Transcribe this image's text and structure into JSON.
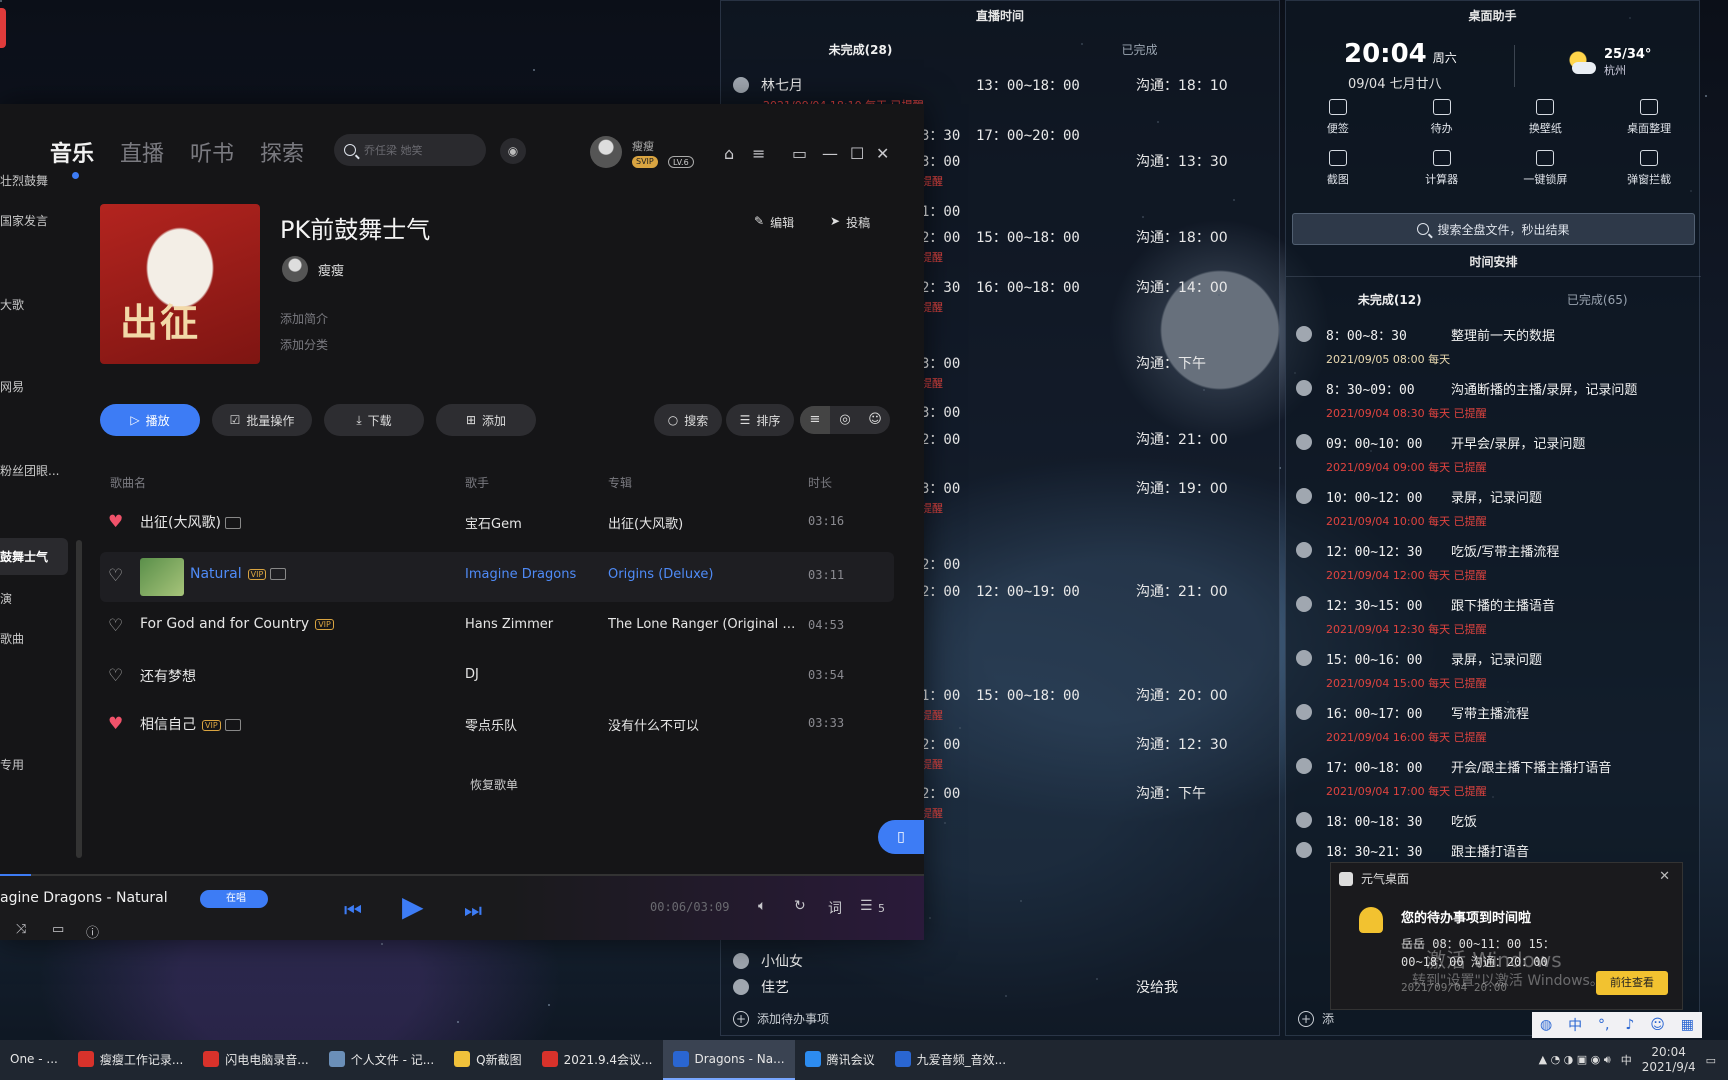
{
  "live_panel": {
    "title": "直播时间",
    "tabs": [
      "未完成(28)",
      "已完成"
    ],
    "rows": [
      {
        "name": "林七月",
        "suffix": "：",
        "time": "13：00~18：00",
        "comm": "沟通：18：10",
        "remind": "2021/09/04 18:10 每天  已提醒"
      },
      {
        "cut": "3：30",
        "time": "17：00~20：00"
      },
      {
        "cut": "3：00",
        "comm": "沟通：13：30",
        "remind": "提醒"
      },
      {
        "cut": "1：00"
      },
      {
        "cut": "2：00",
        "time": "15：00~18：00",
        "comm": "沟通：18：00",
        "remind": "提醒"
      },
      {
        "cut": "2：30",
        "time": "16：00~18：00",
        "comm": "沟通：14：00",
        "remind": "提醒"
      },
      {
        "cut": "3：00",
        "comm": "沟通：下午",
        "remind": "提醒"
      },
      {
        "cut": "3：00"
      },
      {
        "cut": "2：00",
        "comm": "沟通：21：00"
      },
      {
        "cut": "3：00",
        "comm": "沟通：19：00",
        "remind": "提醒"
      },
      {
        "cut": "2：00"
      },
      {
        "cut": "2：00",
        "time": "12：00~19：00",
        "comm": "沟通：21：00"
      },
      {
        "cut": "1：00",
        "time": "15：00~18：00",
        "comm": "沟通：20：00",
        "remind": "提醒"
      },
      {
        "cut": "2：00",
        "comm": "沟通：12：30",
        "remind": "提醒"
      },
      {
        "cut": "2：00",
        "comm": "沟通：下午",
        "remind": "提醒"
      }
    ],
    "bottom_rows": [
      {
        "name": "小仙女"
      },
      {
        "name": "佳艺",
        "comm": "没给我"
      }
    ],
    "add_label": "添加待办事项"
  },
  "assistant": {
    "title": "桌面助手",
    "time": "20:04",
    "weekday": "周六",
    "date": "09/04 七月廿八",
    "temp": "25/34°",
    "city": "杭州",
    "tools": [
      "便签",
      "待办",
      "换壁纸",
      "桌面整理",
      "截图",
      "计算器",
      "一键锁屏",
      "弹窗拦截"
    ],
    "search": "搜索全盘文件，秒出结果",
    "schedule_title": "时间安排",
    "tabs": [
      "未完成(12)",
      "已完成(65)"
    ],
    "items": [
      {
        "time": "8：00~8：30",
        "task": "整理前一天的数据",
        "note": "2021/09/05 08:00 每天",
        "yellow": true
      },
      {
        "time": "8：30~09：00",
        "task": "沟通断播的主播/录屏，记录问题",
        "note": "2021/09/04 08:30 每天  已提醒"
      },
      {
        "time": "09：00~10：00",
        "task": "开早会/录屏，记录问题",
        "note": "2021/09/04 09:00 每天  已提醒"
      },
      {
        "time": "10：00~12：00",
        "task": "录屏，记录问题",
        "note": "2021/09/04 10:00 每天  已提醒"
      },
      {
        "time": "12：00~12：30",
        "task": "吃饭/写带主播流程",
        "note": "2021/09/04 12:00 每天  已提醒"
      },
      {
        "time": "12：30~15：00",
        "task": "跟下播的主播语音",
        "note": "2021/09/04 12:30 每天  已提醒"
      },
      {
        "time": "15：00~16：00",
        "task": "录屏，记录问题",
        "note": "2021/09/04 15:00 每天  已提醒"
      },
      {
        "time": "16：00~17：00",
        "task": "写带主播流程",
        "note": "2021/09/04 16:00 每天  已提醒"
      },
      {
        "time": "17：00~18：00",
        "task": "开会/跟主播下播主播打语音",
        "note": "2021/09/04 17:00 每天  已提醒"
      },
      {
        "time": "18：00~18：30",
        "task": "吃饭"
      },
      {
        "time": "18：30~21：30",
        "task": "跟主播打语音"
      }
    ],
    "add_label": "添"
  },
  "player": {
    "nav": [
      "音乐",
      "直播",
      "听书",
      "探索"
    ],
    "search_placeholder": "乔任梁 她笑",
    "username": "瘦瘦",
    "badge_vip": "SVIP",
    "badge_lv": "LV.6",
    "sidebar": [
      "壮烈鼓舞",
      "国家发言",
      "大歌",
      "网易",
      "粉丝团眼...",
      "鼓舞士气",
      "演",
      "歌曲",
      "专用"
    ],
    "playlist_title": "PK前鼓舞士气",
    "owner": "瘦瘦",
    "add_intro": "添加简介",
    "add_category": "添加分类",
    "edit": "编辑",
    "submit": "投稿",
    "buttons": {
      "play": "播放",
      "batch": "批量操作",
      "download": "下载",
      "add": "添加",
      "search": "搜索",
      "sort": "排序"
    },
    "columns": {
      "song": "歌曲名",
      "singer": "歌手",
      "album": "专辑",
      "duration": "时长"
    },
    "tracks": [
      {
        "title": "出征(大风歌)",
        "singer": "宝石Gem",
        "album": "出征(大风歌)",
        "duration": "03:16",
        "liked": true,
        "vip": false,
        "mv": true
      },
      {
        "title": "Natural",
        "singer": "Imagine Dragons",
        "album": "Origins (Deluxe)",
        "duration": "03:11",
        "liked": false,
        "vip": true,
        "mv": true,
        "playing": true
      },
      {
        "title": "For God and for Country",
        "singer": "Hans Zimmer",
        "album": "The Lone Ranger (Original M...",
        "duration": "04:53",
        "liked": false,
        "vip": true,
        "mv": false
      },
      {
        "title": "还有梦想",
        "singer": "DJ",
        "album": "",
        "duration": "03:54",
        "liked": false,
        "vip": false,
        "mv": false
      },
      {
        "title": "相信自己",
        "singer": "零点乐队",
        "album": "没有什么不可以",
        "duration": "03:33",
        "liked": true,
        "vip": true,
        "mv": true
      }
    ],
    "restore": "恢复歌单",
    "now_playing": "agine Dragons - Natural",
    "playing_label": "在唱",
    "time": "00:06/03:09",
    "lyric": "词",
    "queue_count": "5",
    "progress": 0.034,
    "cover_text": "出征"
  },
  "notification": {
    "app": "元气桌面",
    "title": "您的待办事项到时间啦",
    "line1": "岳岳      08：00~11：00    15：",
    "line2": "00~18：00        沟通：20：00",
    "line3": "2021/09/04  20:00",
    "button": "前往查看"
  },
  "watermark": {
    "line1": "激活 Windows",
    "line2": "转到\"设置\"以激活 Windows。"
  },
  "taskbar": {
    "items": [
      "One - ...",
      "瘦瘦工作记录...",
      "闪电电脑录音...",
      "个人文件 - 记...",
      "Q新截图",
      "2021.9.4会议...",
      "Dragons - Na...",
      "腾讯会议",
      "九爱音频_音效..."
    ],
    "active_index": 6,
    "clock_time": "20:04",
    "clock_date": "2021/9/4",
    "ime": "中"
  }
}
